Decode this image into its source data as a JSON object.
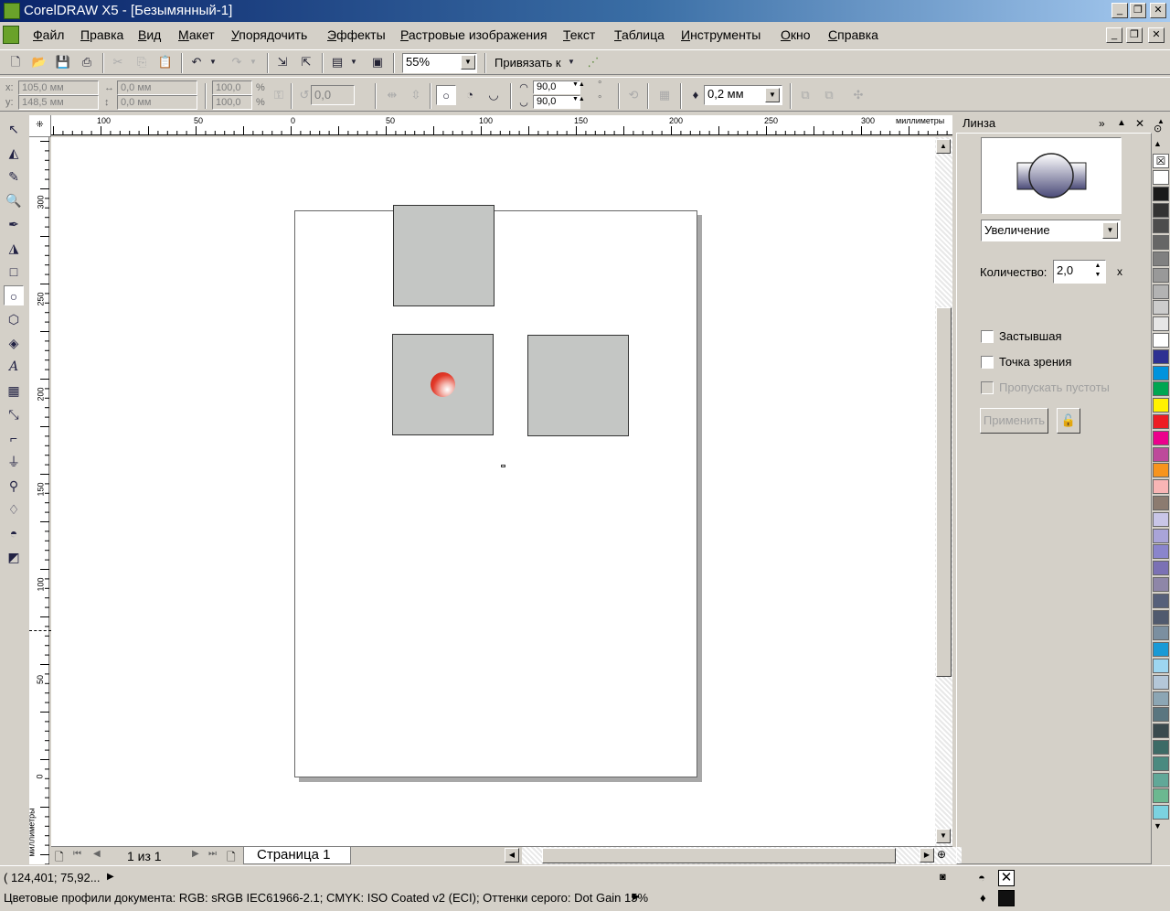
{
  "window": {
    "title": "CorelDRAW X5 - [Безымянный-1]"
  },
  "menu": [
    "Файл",
    "Правка",
    "Вид",
    "Макет",
    "Упорядочить",
    "Эффекты",
    "Растровые изображения",
    "Текст",
    "Таблица",
    "Инструменты",
    "Окно",
    "Справка"
  ],
  "toolbar": {
    "zoom": "55%",
    "snap_label": "Привязать к"
  },
  "propbar": {
    "x_label": "x:",
    "x": "105,0 мм",
    "y_label": "y:",
    "y": "148,5 мм",
    "w": "0,0 мм",
    "h": "0,0 мм",
    "scale_w": "100,0",
    "scale_h": "100,0",
    "pct": "%",
    "angle": "0,0",
    "arc_start": "90,0",
    "arc_end": "90,0",
    "deg": "°",
    "outline": "0,2 мм"
  },
  "rulers": {
    "h_ticks": [
      "100",
      "50",
      "0",
      "50",
      "100",
      "150",
      "200",
      "250",
      "300"
    ],
    "h_unit": "миллиметры",
    "v_ticks": [
      "300",
      "250",
      "200",
      "150",
      "100",
      "50",
      "0"
    ],
    "v_unit": "миллиметры"
  },
  "pagenav": {
    "counter": "1 из 1",
    "tab": "Страница 1"
  },
  "docker": {
    "title": "Линза",
    "lens_type": "Увеличение",
    "amount_label": "Количество:",
    "amount": "2,0",
    "amount_unit": "x",
    "frozen": "Застывшая",
    "viewpoint": "Точка зрения",
    "skip_blanks": "Пропускать пустоты",
    "apply": "Применить"
  },
  "status": {
    "coords": "( 124,401; 75,92... ",
    "profiles": "Цветовые профили документа: RGB: sRGB IEC61966-2.1; CMYK: ISO Coated v2 (ECI); Оттенки серого: Dot Gain 15%"
  },
  "colors": {
    "palette": [
      "#ffffff",
      "#1a1a1a",
      "#333333",
      "#4d4d4d",
      "#666666",
      "#808080",
      "#999999",
      "#b3b3b3",
      "#cccccc",
      "#e6e6e6",
      "#ffffff",
      "#2e3192",
      "#0093dd",
      "#00a651",
      "#fff200",
      "#ed1c24",
      "#ec008c",
      "#bd4a9b",
      "#f7941d",
      "#f9b5b5",
      "#8c7b70",
      "#c9c6e8",
      "#a9a4d8",
      "#8a85cc",
      "#7b71b4",
      "#8e86a8",
      "#56607a",
      "#505a6e",
      "#7b8fa0",
      "#1a9ad6",
      "#9dd6f0",
      "#b4c7d8",
      "#8ca6b4",
      "#5a7680",
      "#3a4a4e",
      "#3d6b66",
      "#4a8a80",
      "#61a898",
      "#6cb890",
      "#7bd2e0"
    ]
  }
}
